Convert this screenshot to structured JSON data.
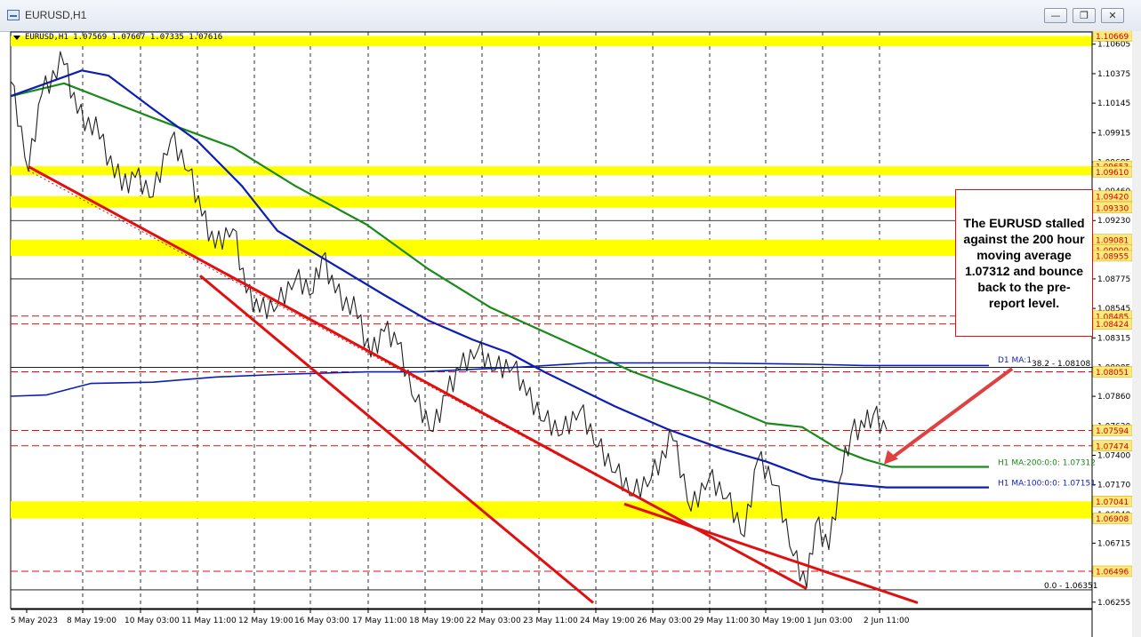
{
  "window": {
    "title": "EURUSD,H1",
    "icon": "chart-window-icon",
    "controls": [
      "minimize-icon",
      "restore-icon",
      "close-icon"
    ]
  },
  "info_line": "EURUSD,H1  1.07569 1.07667 1.07335 1.07616",
  "callout": "The EURUSD stalled against the 200 hour moving average 1.07312 and bounce back to the pre-report level.",
  "colors": {
    "candle": "#222222",
    "ma100": "#0b1fb5",
    "ma200": "#1a8a1a",
    "d1ma": "#0b1fb5",
    "zone": "#ffff00",
    "trend": "#e01010",
    "price_label_bg": "#ffe97a",
    "price_label_text": "#d10000"
  },
  "chart_data": {
    "type": "line",
    "symbol": "EURUSD",
    "timeframe": "H1",
    "ylim": [
      1.0618,
      1.0678
    ],
    "x_ticks": [
      "5 May 2023",
      "8 May 19:00",
      "10 May 03:00",
      "11 May 11:00",
      "12 May 19:00",
      "16 May 03:00",
      "17 May 11:00",
      "18 May 19:00",
      "22 May 03:00",
      "23 May 11:00",
      "24 May 19:00",
      "26 May 03:00",
      "29 May 11:00",
      "30 May 19:00",
      "1 Jun 03:00",
      "2 Jun 11:00"
    ],
    "y_ticks": [
      "1.10605",
      "1.10375",
      "1.10145",
      "1.09915",
      "1.09685",
      "1.09460",
      "1.09230",
      "1.09000",
      "1.08775",
      "1.08545",
      "1.08315",
      "1.08085",
      "1.07860",
      "1.07630",
      "1.07400",
      "1.07170",
      "1.06940",
      "1.06715",
      "1.06485",
      "1.06255"
    ],
    "price_labels": [
      "1.10669",
      "1.09653",
      "1.09610",
      "1.09420",
      "1.09330",
      "1.09081",
      "1.09000",
      "1.08955",
      "1.08485",
      "1.08424",
      "1.08051",
      "1.07594",
      "1.07474",
      "1.07041",
      "1.06908",
      "1.06496"
    ],
    "ma_labels": [
      "D1 MA:1",
      "H1 MA:200:0:0: 1.07312",
      "H1 MA:100:0:0: 1.07151"
    ],
    "fib_labels": [
      "38.2 - 1.08108",
      "0.0 - 1.06351"
    ],
    "zones": [
      [
        1.1059,
        1.10669
      ],
      [
        1.0961,
        1.09653
      ],
      [
        1.0933,
        1.0942
      ],
      [
        1.08955,
        1.09081
      ],
      [
        1.06908,
        1.07041
      ]
    ],
    "dashed_levels": [
      1.08485,
      1.08424,
      1.08051,
      1.07594,
      1.07474,
      1.06496
    ],
    "solid_levels": [
      1.0923,
      1.08775,
      1.08085,
      1.06351
    ],
    "series": [
      {
        "name": "H1 MA:200",
        "values": [
          [
            0,
            1.102
          ],
          [
            60,
            1.103
          ],
          [
            160,
            1.1003
          ],
          [
            250,
            1.098
          ],
          [
            320,
            1.095
          ],
          [
            400,
            1.092
          ],
          [
            470,
            1.0885
          ],
          [
            540,
            1.0855
          ],
          [
            620,
            1.083
          ],
          [
            700,
            1.0805
          ],
          [
            780,
            1.0785
          ],
          [
            850,
            1.0765
          ],
          [
            890,
            1.0762
          ],
          [
            930,
            1.0745
          ],
          [
            960,
            1.0737
          ],
          [
            990,
            1.0731
          ],
          [
            1100,
            1.0731
          ]
        ]
      },
      {
        "name": "H1 MA:100",
        "values": [
          [
            0,
            1.102
          ],
          [
            40,
            1.103
          ],
          [
            80,
            1.104
          ],
          [
            110,
            1.1036
          ],
          [
            160,
            1.101
          ],
          [
            210,
            1.0985
          ],
          [
            260,
            1.095
          ],
          [
            300,
            1.0915
          ],
          [
            360,
            1.089
          ],
          [
            420,
            1.0865
          ],
          [
            470,
            1.0845
          ],
          [
            520,
            1.083
          ],
          [
            560,
            1.082
          ],
          [
            600,
            1.0805
          ],
          [
            680,
            1.0778
          ],
          [
            740,
            1.076
          ],
          [
            800,
            1.0745
          ],
          [
            850,
            1.0735
          ],
          [
            900,
            1.0722
          ],
          [
            935,
            1.0718
          ],
          [
            985,
            1.0715
          ],
          [
            1100,
            1.0715
          ]
        ]
      },
      {
        "name": "D1 MA",
        "values": [
          [
            0,
            1.0786
          ],
          [
            40,
            1.0787
          ],
          [
            90,
            1.0796
          ],
          [
            160,
            1.0797
          ],
          [
            230,
            1.0801
          ],
          [
            300,
            1.0803
          ],
          [
            400,
            1.0805
          ],
          [
            460,
            1.0805
          ],
          [
            580,
            1.0809
          ],
          [
            650,
            1.0812
          ],
          [
            780,
            1.0812
          ],
          [
            900,
            1.0811
          ],
          [
            960,
            1.081
          ],
          [
            1100,
            1.081
          ]
        ]
      },
      {
        "name": "price",
        "values": [
          [
            0,
            1.1035
          ],
          [
            20,
            1.0965
          ],
          [
            35,
            1.1025
          ],
          [
            60,
            1.1048
          ],
          [
            75,
            1.101
          ],
          [
            100,
            1.099
          ],
          [
            125,
            1.095
          ],
          [
            140,
            1.096
          ],
          [
            160,
            1.0945
          ],
          [
            180,
            1.099
          ],
          [
            200,
            1.0965
          ],
          [
            215,
            1.093
          ],
          [
            230,
            1.0905
          ],
          [
            250,
            1.092
          ],
          [
            265,
            1.087
          ],
          [
            280,
            1.0855
          ],
          [
            300,
            1.086
          ],
          [
            320,
            1.088
          ],
          [
            340,
            1.087
          ],
          [
            350,
            1.0898
          ],
          [
            365,
            1.087
          ],
          [
            390,
            1.085
          ],
          [
            405,
            1.082
          ],
          [
            420,
            1.084
          ],
          [
            435,
            1.083
          ],
          [
            455,
            1.0785
          ],
          [
            475,
            1.0762
          ],
          [
            490,
            1.079
          ],
          [
            505,
            1.081
          ],
          [
            525,
            1.0825
          ],
          [
            545,
            1.081
          ],
          [
            565,
            1.0812
          ],
          [
            580,
            1.079
          ],
          [
            600,
            1.077
          ],
          [
            620,
            1.076
          ],
          [
            640,
            1.0778
          ],
          [
            660,
            1.075
          ],
          [
            680,
            1.073
          ],
          [
            700,
            1.0712
          ],
          [
            720,
            1.0725
          ],
          [
            745,
            1.0755
          ],
          [
            765,
            1.07
          ],
          [
            785,
            1.0725
          ],
          [
            805,
            1.071
          ],
          [
            825,
            1.068
          ],
          [
            840,
            1.074
          ],
          [
            860,
            1.072
          ],
          [
            880,
            1.0665
          ],
          [
            895,
            1.064
          ],
          [
            905,
            1.069
          ],
          [
            920,
            1.067
          ],
          [
            935,
            1.073
          ],
          [
            945,
            1.076
          ],
          [
            960,
            1.0765
          ],
          [
            970,
            1.0775
          ],
          [
            985,
            1.076
          ]
        ]
      }
    ],
    "trend_lines": [
      [
        [
          20,
          1.0965
        ],
        [
          895,
          1.0636
        ]
      ],
      [
        [
          213,
          1.088
        ],
        [
          655,
          1.0625
        ]
      ],
      [
        [
          690,
          1.0702
        ],
        [
          1020,
          1.0625
        ]
      ]
    ]
  }
}
